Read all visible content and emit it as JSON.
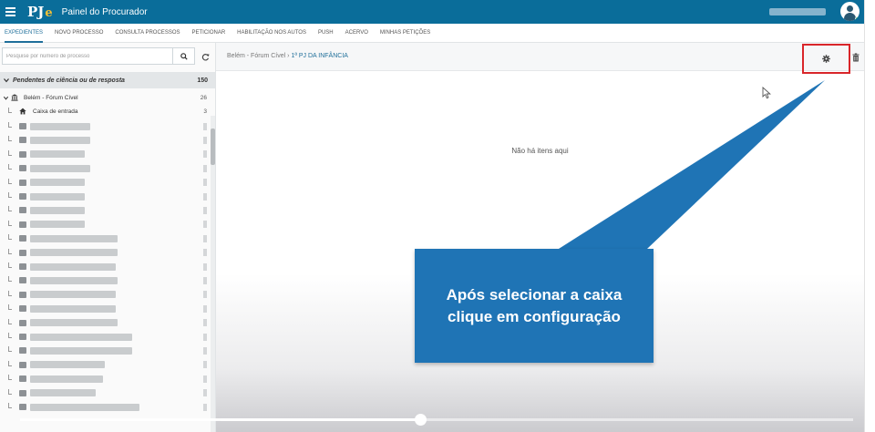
{
  "app": {
    "logo": "PJ",
    "logo_suffix": "e",
    "title": "Painel do Procurador"
  },
  "nav": {
    "tabs": [
      "EXPEDIENTES",
      "NOVO PROCESSO",
      "CONSULTA PROCESSOS",
      "PETICIONAR",
      "HABILITAÇÃO NOS AUTOS",
      "PUSH",
      "ACERVO",
      "MINHAS PETIÇÕES"
    ],
    "active_tab": "EXPEDIENTES"
  },
  "sidebar": {
    "search_placeholder": "Pesquise por número de processo",
    "section_label": "Pendentes de ciência ou de resposta",
    "section_count": "150",
    "location_label": "Belém - Fórum Cível",
    "location_count": "26",
    "inbox_label": "Caixa de entrada",
    "inbox_count": "3",
    "redacted_rows": 21
  },
  "main": {
    "breadcrumb_base": "Belém - Fórum Cível",
    "breadcrumb_sep": "›",
    "breadcrumb_current": "1ª PJ DA INFÂNCIA",
    "empty_message": "Não há itens aqui"
  },
  "callout": {
    "line1": "Após selecionar a caixa",
    "line2": "clique em configuração",
    "color": "#1f74b5"
  },
  "highlight_color": "#d9262a",
  "video": {
    "progress": 0.48
  },
  "icons": {
    "menu": "hamburger-menu-icon",
    "user": "user-avatar-icon",
    "search": "search-icon",
    "refresh": "refresh-icon",
    "home": "home-icon",
    "building": "courthouse-icon",
    "gear": "gear-icon",
    "trash": "trash-icon",
    "cursor": "mouse-cursor-icon"
  }
}
